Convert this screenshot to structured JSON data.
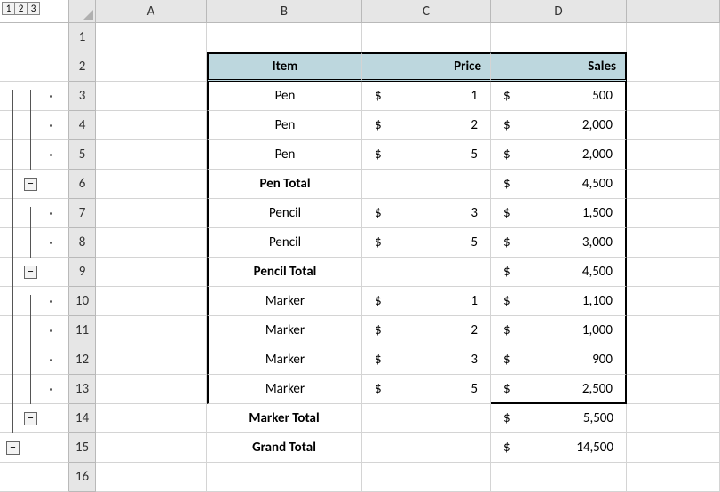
{
  "outline_levels": [
    "1",
    "2",
    "3"
  ],
  "columns": [
    "A",
    "B",
    "C",
    "D"
  ],
  "row_numbers": [
    "1",
    "2",
    "3",
    "4",
    "5",
    "6",
    "7",
    "8",
    "9",
    "10",
    "11",
    "12",
    "13",
    "14",
    "15",
    "16"
  ],
  "headers": {
    "item": "Item",
    "price": "Price",
    "sales": "Sales"
  },
  "currency_symbol": "$",
  "rows": [
    {
      "item": "Pen",
      "price": "1",
      "sales": "500",
      "bold": false,
      "hasPrice": true
    },
    {
      "item": "Pen",
      "price": "2",
      "sales": "2,000",
      "bold": false,
      "hasPrice": true
    },
    {
      "item": "Pen",
      "price": "5",
      "sales": "2,000",
      "bold": false,
      "hasPrice": true
    },
    {
      "item": "Pen Total",
      "price": "",
      "sales": "4,500",
      "bold": true,
      "hasPrice": false
    },
    {
      "item": "Pencil",
      "price": "3",
      "sales": "1,500",
      "bold": false,
      "hasPrice": true
    },
    {
      "item": "Pencil",
      "price": "5",
      "sales": "3,000",
      "bold": false,
      "hasPrice": true
    },
    {
      "item": "Pencil Total",
      "price": "",
      "sales": "4,500",
      "bold": true,
      "hasPrice": false
    },
    {
      "item": "Marker",
      "price": "1",
      "sales": "1,100",
      "bold": false,
      "hasPrice": true
    },
    {
      "item": "Marker",
      "price": "2",
      "sales": "1,000",
      "bold": false,
      "hasPrice": true
    },
    {
      "item": "Marker",
      "price": "3",
      "sales": "900",
      "bold": false,
      "hasPrice": true
    },
    {
      "item": "Marker",
      "price": "5",
      "sales": "2,500",
      "bold": false,
      "hasPrice": true
    },
    {
      "item": "Marker Total",
      "price": "",
      "sales": "5,500",
      "bold": true,
      "hasPrice": false
    },
    {
      "item": "Grand Total",
      "price": "",
      "sales": "14,500",
      "bold": true,
      "hasPrice": false
    }
  ],
  "collapse_label": "−"
}
